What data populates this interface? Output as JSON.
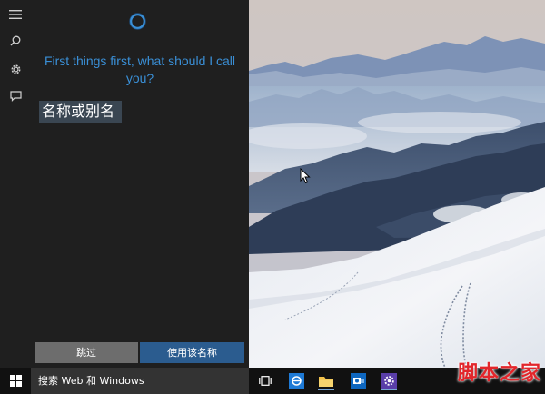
{
  "cortana": {
    "prompt": "First things first, what should I call you?",
    "name_input": {
      "value": "",
      "placeholder": "名称或别名"
    },
    "skip_label": "跳过",
    "use_label": "使用该名称"
  },
  "rail": {
    "icons": [
      "hamburger-menu-icon",
      "search-icon",
      "settings-gear-icon",
      "feedback-icon"
    ]
  },
  "taskbar": {
    "search_placeholder": "搜索 Web 和 Windows",
    "watermark_text": "脚本之家",
    "pinned": [
      "task-view-icon",
      "internet-explorer-icon",
      "file-explorer-icon",
      "outlook-icon",
      "settings-icon"
    ]
  },
  "colors": {
    "accent_blue": "#3a8fd6",
    "panel_bg": "#1f1f1f",
    "use_button": "#2b5c8f",
    "skip_button": "#6d6d6d",
    "watermark_red": "#e2262b"
  }
}
